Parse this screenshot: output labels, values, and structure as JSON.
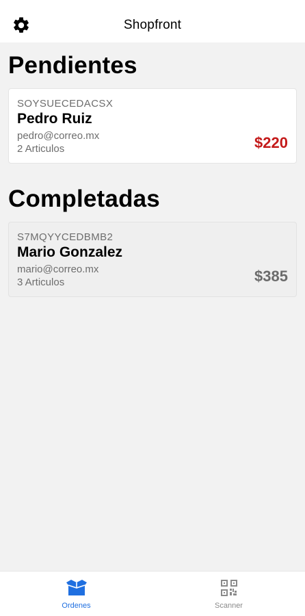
{
  "header": {
    "title": "Shopfront",
    "settings_icon": "gear-icon"
  },
  "pending": {
    "section_title": "Pendientes",
    "orders": [
      {
        "code": "SOYSUECEDACSX",
        "name": "Pedro Ruiz",
        "email": "pedro@correo.mx",
        "items": "2 Articulos",
        "total": "$220",
        "total_color": "#c41a1a"
      }
    ]
  },
  "completed": {
    "section_title": "Completadas",
    "orders": [
      {
        "code": "S7MQYYCEDBMB2",
        "name": "Mario Gonzalez",
        "email": "mario@correo.mx",
        "items": "3 Articulos",
        "total": "$385",
        "total_color": "#6b6b6b"
      }
    ]
  },
  "tabbar": {
    "tabs": [
      {
        "label": "Ordenes",
        "icon": "box-icon",
        "active": true,
        "color": "#1f6fe0"
      },
      {
        "label": "Scanner",
        "icon": "qr-code-icon",
        "active": false,
        "color": "#8a8a8a"
      }
    ]
  }
}
